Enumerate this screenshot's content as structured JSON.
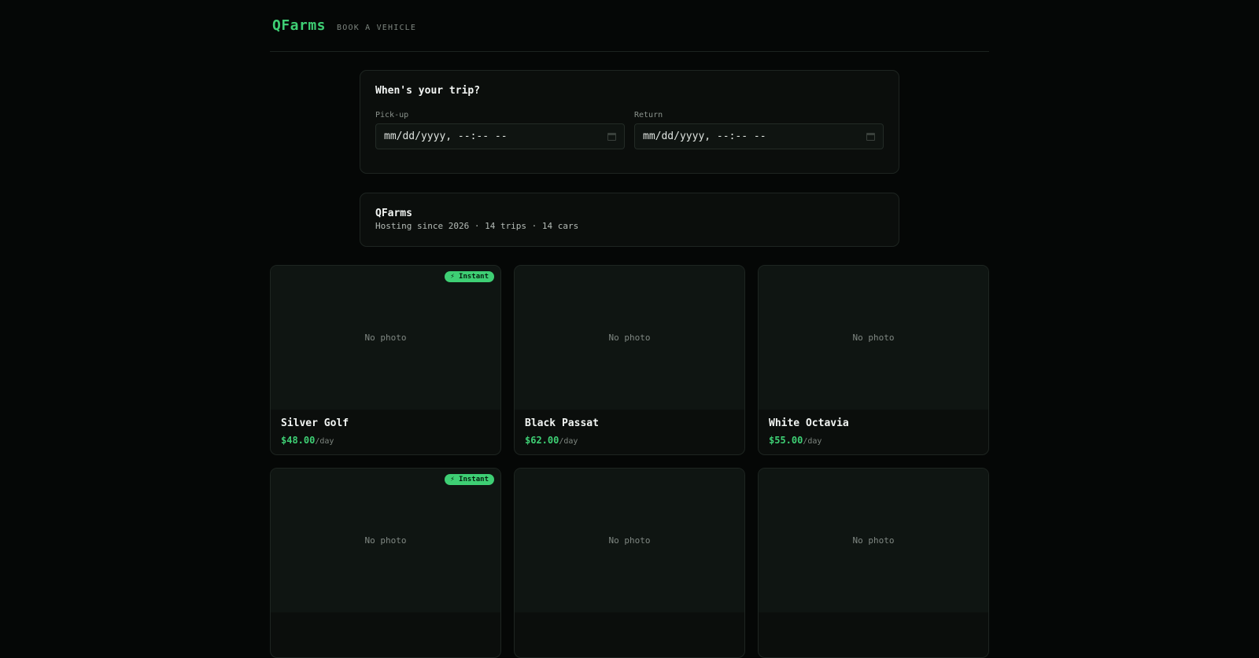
{
  "header": {
    "brand": "QFarms",
    "subtitle": "BOOK A VEHICLE"
  },
  "trip": {
    "title": "When's your trip?",
    "pickup_label": "Pick-up",
    "pickup_value": "mm/dd/yyyy, --:-- --",
    "return_label": "Return",
    "return_value": "mm/dd/yyyy, --:-- --",
    "calendar_icon": "calendar-icon"
  },
  "host": {
    "name": "QFarms",
    "meta": "Hosting since 2026 · 14 trips · 14 cars"
  },
  "cars": [
    {
      "name": "Silver Golf",
      "price": "$48.00",
      "per": "/day",
      "photo": "No photo",
      "badge": "⚡ Instant"
    },
    {
      "name": "Black Passat",
      "price": "$62.00",
      "per": "/day",
      "photo": "No photo",
      "badge": ""
    },
    {
      "name": "White Octavia",
      "price": "$55.00",
      "per": "/day",
      "photo": "No photo",
      "badge": ""
    },
    {
      "name": "",
      "price": "",
      "per": "",
      "photo": "No photo",
      "badge": "⚡ Instant"
    },
    {
      "name": "",
      "price": "",
      "per": "",
      "photo": "No photo",
      "badge": ""
    },
    {
      "name": "",
      "price": "",
      "per": "",
      "photo": "No photo",
      "badge": ""
    }
  ],
  "colors": {
    "accent": "#3ecf74",
    "background": "#050706",
    "card": "#0b0e0c"
  }
}
